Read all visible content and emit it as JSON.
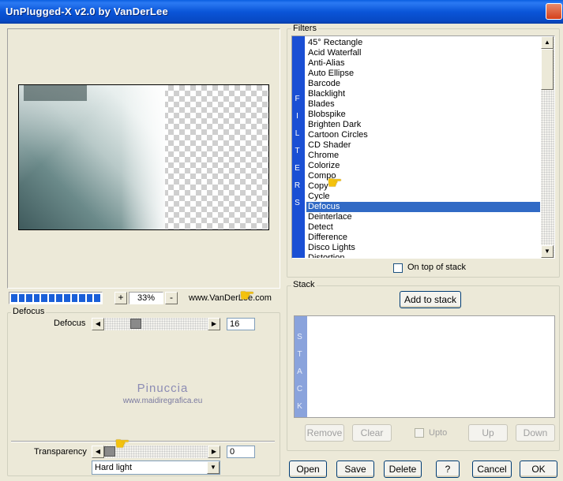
{
  "window": {
    "title": "UnPlugged-X v2.0 by VanDerLee",
    "close_glyph": "✕"
  },
  "preview": {
    "zoom_minus": "-",
    "zoom_plus": "+",
    "zoom_value": "33%",
    "website": "www.VanDerLee.com"
  },
  "defocus_group": {
    "label": "Defocus",
    "param_label": "Defocus",
    "param_value": "16",
    "param_level": 0.28
  },
  "watermark": {
    "name": "Pinuccia",
    "site": "www.maidiregrafica.eu"
  },
  "transparency": {
    "label": "Transparency",
    "value": "0",
    "level": 0.0,
    "blend_mode": "Hard light"
  },
  "filters": {
    "label": "Filters",
    "vertical_label": "F I L T E R S",
    "items": [
      "45° Rectangle",
      "Acid Waterfall",
      "Anti-Alias",
      "Auto Ellipse",
      "Barcode",
      "Blacklight",
      "Blades",
      "Blobspike",
      "Brighten Dark",
      "Cartoon Circles",
      "CD Shader",
      "Chrome",
      "Colorize",
      "Compo",
      "Copy",
      "Cycle",
      "Defocus",
      "Deinterlace",
      "Detect",
      "Difference",
      "Disco Lights",
      "Distortion"
    ],
    "selected_index": 16,
    "on_top_label": "On top of stack"
  },
  "stack": {
    "label": "Stack",
    "vertical_label": "S T A C K",
    "add_button": "Add to stack",
    "remove_button": "Remove",
    "clear_button": "Clear",
    "upto_label": "Upto",
    "up_button": "Up",
    "down_button": "Down"
  },
  "footer": {
    "open": "Open",
    "save": "Save",
    "delete": "Delete",
    "help": "?",
    "cancel": "Cancel",
    "ok": "OK"
  },
  "icons": {
    "arrow_left": "◀",
    "arrow_right": "▶",
    "arrow_up": "▲",
    "arrow_down": "▼",
    "pointer_hand": "☛"
  },
  "colors": {
    "titlebar": "#0a55d8",
    "selection": "#316ac5",
    "filters_bar": "#1a4fd4",
    "stack_bar": "#8aa3dc",
    "progress": "#1a5fd8"
  }
}
